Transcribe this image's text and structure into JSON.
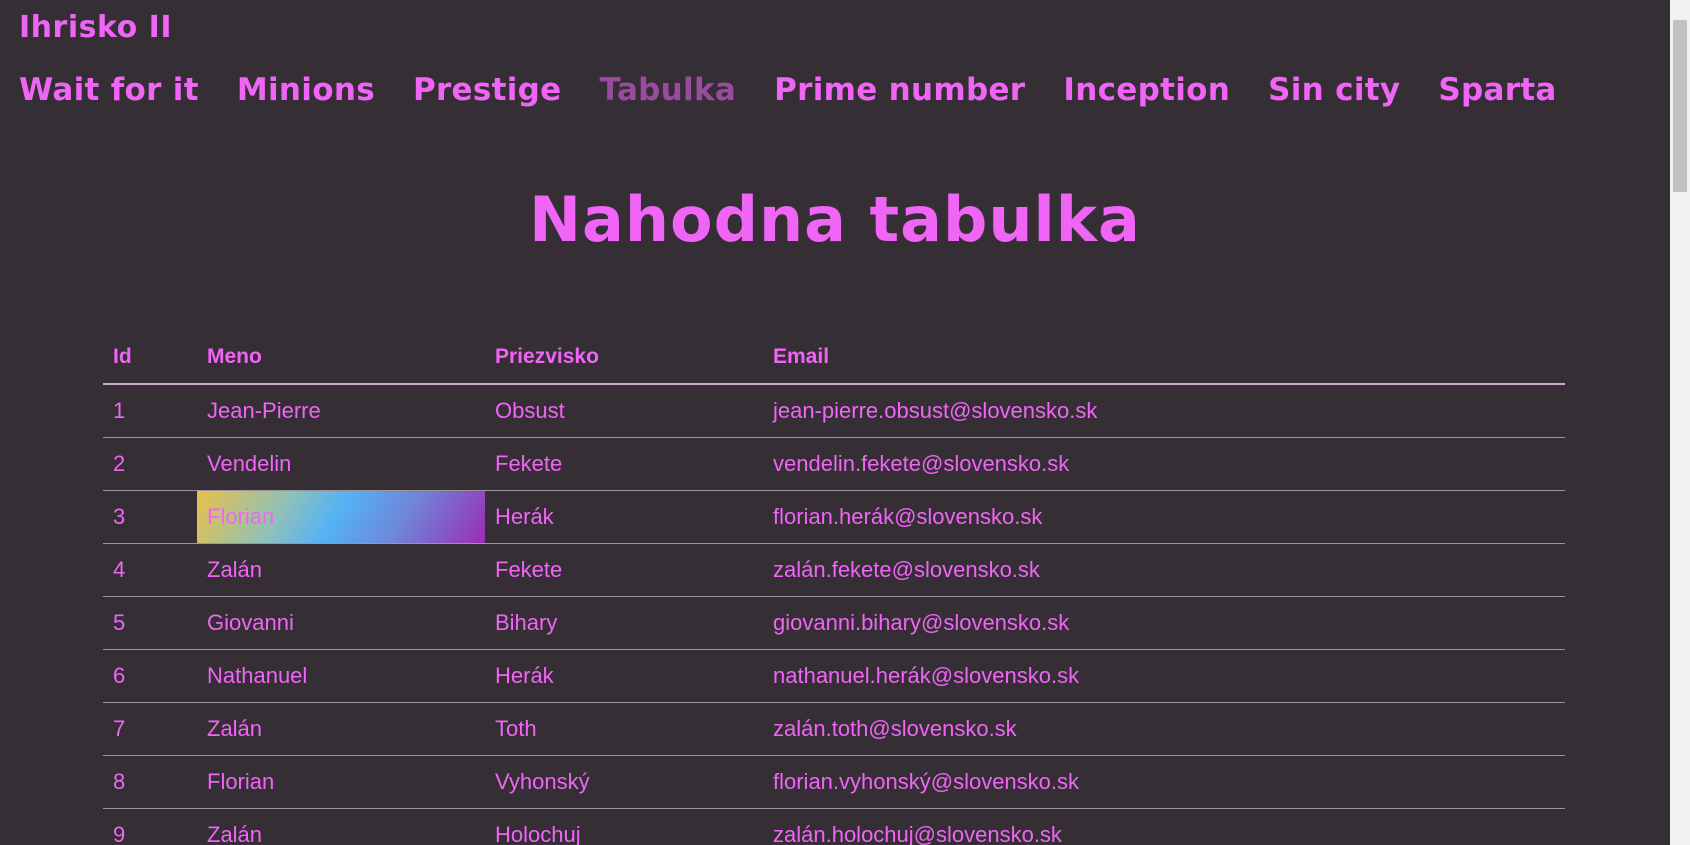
{
  "header": {
    "brand": "Ihrisko II",
    "nav": [
      {
        "label": "Wait for it",
        "active": false
      },
      {
        "label": "Minions",
        "active": false
      },
      {
        "label": "Prestige",
        "active": false
      },
      {
        "label": "Tabulka",
        "active": true
      },
      {
        "label": "Prime number",
        "active": false
      },
      {
        "label": "Inception",
        "active": false
      },
      {
        "label": "Sin city",
        "active": false
      },
      {
        "label": "Sparta",
        "active": false
      }
    ]
  },
  "main": {
    "title": "Nahodna tabulka",
    "table": {
      "columns": [
        "Id",
        "Meno",
        "Priezvisko",
        "Email"
      ],
      "rows": [
        [
          "1",
          "Jean-Pierre",
          "Obsust",
          "jean-pierre.obsust@slovensko.sk"
        ],
        [
          "2",
          "Vendelin",
          "Fekete",
          "vendelin.fekete@slovensko.sk"
        ],
        [
          "3",
          "Florian",
          "Herák",
          "florian.herák@slovensko.sk"
        ],
        [
          "4",
          "Zalán",
          "Fekete",
          "zalán.fekete@slovensko.sk"
        ],
        [
          "5",
          "Giovanni",
          "Bihary",
          "giovanni.bihary@slovensko.sk"
        ],
        [
          "6",
          "Nathanuel",
          "Herák",
          "nathanuel.herák@slovensko.sk"
        ],
        [
          "7",
          "Zalán",
          "Toth",
          "zalán.toth@slovensko.sk"
        ],
        [
          "8",
          "Florian",
          "Vyhonský",
          "florian.vyhonský@slovensko.sk"
        ],
        [
          "9",
          "Zalán",
          "Holochuj",
          "zalán.holochuj@slovensko.sk"
        ]
      ]
    }
  },
  "colors": {
    "background": "#352f35",
    "accent": "#f065f6",
    "nav_active": "#9a4aa0"
  }
}
